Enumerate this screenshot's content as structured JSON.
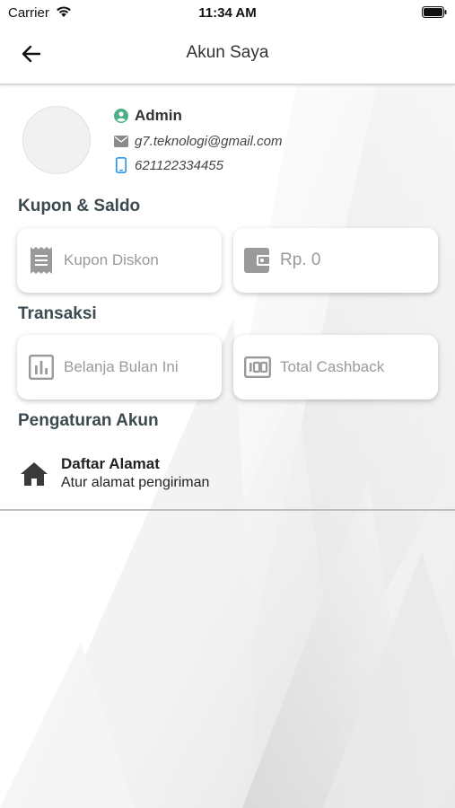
{
  "status_bar": {
    "carrier": "Carrier",
    "time": "11:34 AM"
  },
  "app_bar": {
    "title": "Akun Saya"
  },
  "profile": {
    "name": "Admin",
    "email": "g7.teknologi@gmail.com",
    "phone": "621122334455"
  },
  "sections": {
    "kupon_saldo": "Kupon & Saldo",
    "transaksi": "Transaksi",
    "pengaturan": "Pengaturan Akun"
  },
  "cards": {
    "kupon_diskon": "Kupon Diskon",
    "saldo": "Rp. 0",
    "belanja": "Belanja Bulan Ini",
    "cashback": "Total Cashback"
  },
  "menu": {
    "daftar_alamat": {
      "title": "Daftar Alamat",
      "subtitle": "Atur alamat pengiriman"
    }
  },
  "colors": {
    "accent_green": "#4caf8a",
    "accent_blue": "#2196f3",
    "icon_gray": "#9a9a9a"
  }
}
